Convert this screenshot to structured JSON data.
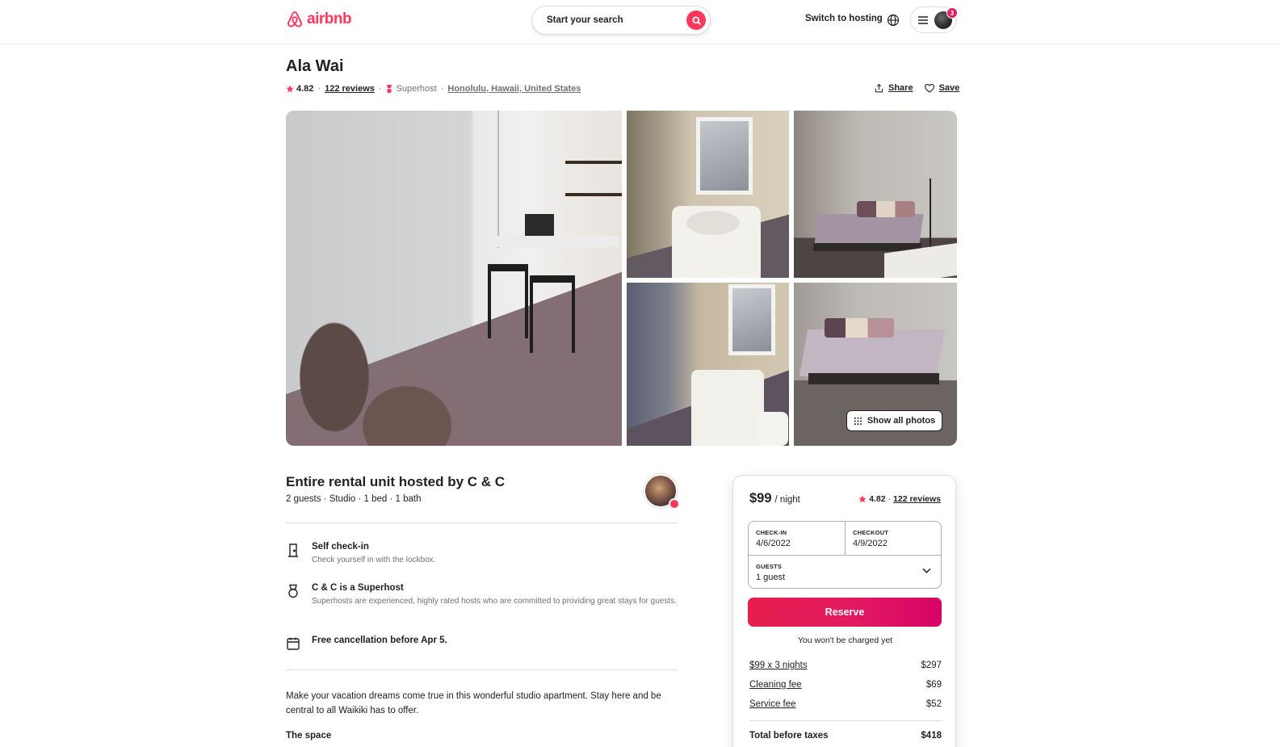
{
  "header": {
    "logo_text": "airbnb",
    "search_placeholder": "Start your search",
    "switch_hosting": "Switch to hosting",
    "notification_count": "3"
  },
  "listing": {
    "title": "Ala Wai",
    "rating": "4.82",
    "reviews": "122 reviews",
    "superhost": "Superhost",
    "location": "Honolulu, Hawaii, United States",
    "share_label": "Share",
    "save_label": "Save",
    "show_all_photos": "Show all photos"
  },
  "host": {
    "title": "Entire rental unit hosted by C & C",
    "details": "2 guests · Studio · 1 bed · 1 bath"
  },
  "features": [
    {
      "icon": "door-icon",
      "title": "Self check-in",
      "desc": "Check yourself in with the lockbox."
    },
    {
      "icon": "medal-icon",
      "title": "C & C is a Superhost",
      "desc": "Superhosts are experienced, highly rated hosts who are committed to providing great stays for guests."
    },
    {
      "icon": "calendar-icon",
      "title": "Free cancellation before Apr 5.",
      "desc": ""
    }
  ],
  "description": "Make your vacation dreams come true in this wonderful studio apartment. Stay here and be central to all Waikiki has to offer.",
  "the_space": "The space",
  "booking": {
    "price": "$99",
    "per_night": "/ night",
    "rating": "4.82",
    "reviews": "122 reviews",
    "checkin_label": "CHECK-IN",
    "checkin_value": "4/6/2022",
    "checkout_label": "CHECKOUT",
    "checkout_value": "4/9/2022",
    "guests_label": "GUESTS",
    "guests_value": "1 guest",
    "reserve_label": "Reserve",
    "not_charged": "You won't be charged yet",
    "fees": [
      {
        "label": "$99 x 3 nights",
        "amount": "$297"
      },
      {
        "label": "Cleaning fee",
        "amount": "$69"
      },
      {
        "label": "Service fee",
        "amount": "$52"
      }
    ],
    "total_label": "Total before taxes",
    "total_amount": "$418"
  },
  "colors": {
    "brand": "#ff385c",
    "text": "#222222",
    "muted": "#717171",
    "border": "#dddddd"
  }
}
